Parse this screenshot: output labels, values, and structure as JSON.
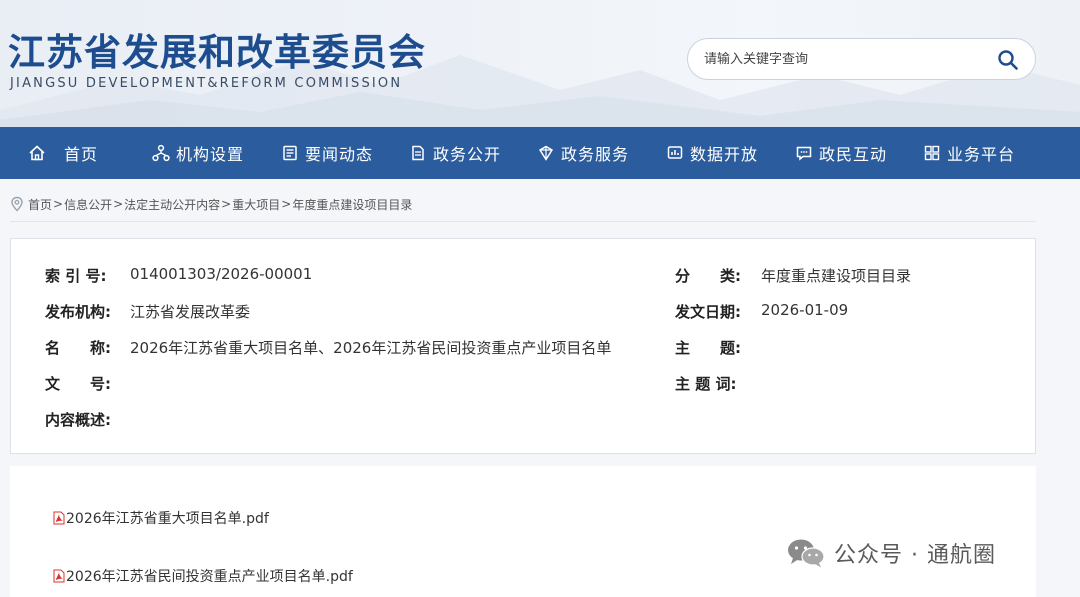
{
  "header": {
    "title": "江苏省发展和改革委员会",
    "subtitle": "JIANGSU DEVELOPMENT&REFORM COMMISSION",
    "search_placeholder": "请输入关键字查询"
  },
  "nav": {
    "items": [
      {
        "label": "首页",
        "icon": "home-icon"
      },
      {
        "label": "机构设置",
        "icon": "org-icon"
      },
      {
        "label": "要闻动态",
        "icon": "news-icon"
      },
      {
        "label": "政务公开",
        "icon": "doc-icon"
      },
      {
        "label": "政务服务",
        "icon": "service-icon"
      },
      {
        "label": "数据开放",
        "icon": "data-icon"
      },
      {
        "label": "政民互动",
        "icon": "chat-icon"
      },
      {
        "label": "业务平台",
        "icon": "grid-icon"
      }
    ]
  },
  "breadcrumb": [
    "首页",
    "信息公开",
    "法定主动公开内容",
    "重大项目",
    "年度重点建设项目目录"
  ],
  "breadcrumb_separator": ">",
  "info": {
    "index_label": "索 引 号:",
    "index_value": "014001303/2026-00001",
    "category_label": "分　　类:",
    "category_value": "年度重点建设项目目录",
    "publisher_label": "发布机构:",
    "publisher_value": "江苏省发展改革委",
    "date_label": "发文日期:",
    "date_value": "2026-01-09",
    "name_label": "名　　称:",
    "name_value": "2026年江苏省重大项目名单、2026年江苏省民间投资重点产业项目名单",
    "subject_label": "主　　题:",
    "subject_value": "",
    "docno_label": "文　　号:",
    "docno_value": "",
    "keywords_label": "主 题 词:",
    "keywords_value": "",
    "summary_label": "内容概述:",
    "summary_value": ""
  },
  "attachments": [
    "2026年江苏省重大项目名单.pdf",
    "2026年江苏省民间投资重点产业项目名单.pdf"
  ],
  "watermark": "公众号 · 通航圈",
  "colors": {
    "nav_bg": "#2b5c9d",
    "title_blue": "#1d4c8f",
    "pdf_red": "#d9342b"
  }
}
